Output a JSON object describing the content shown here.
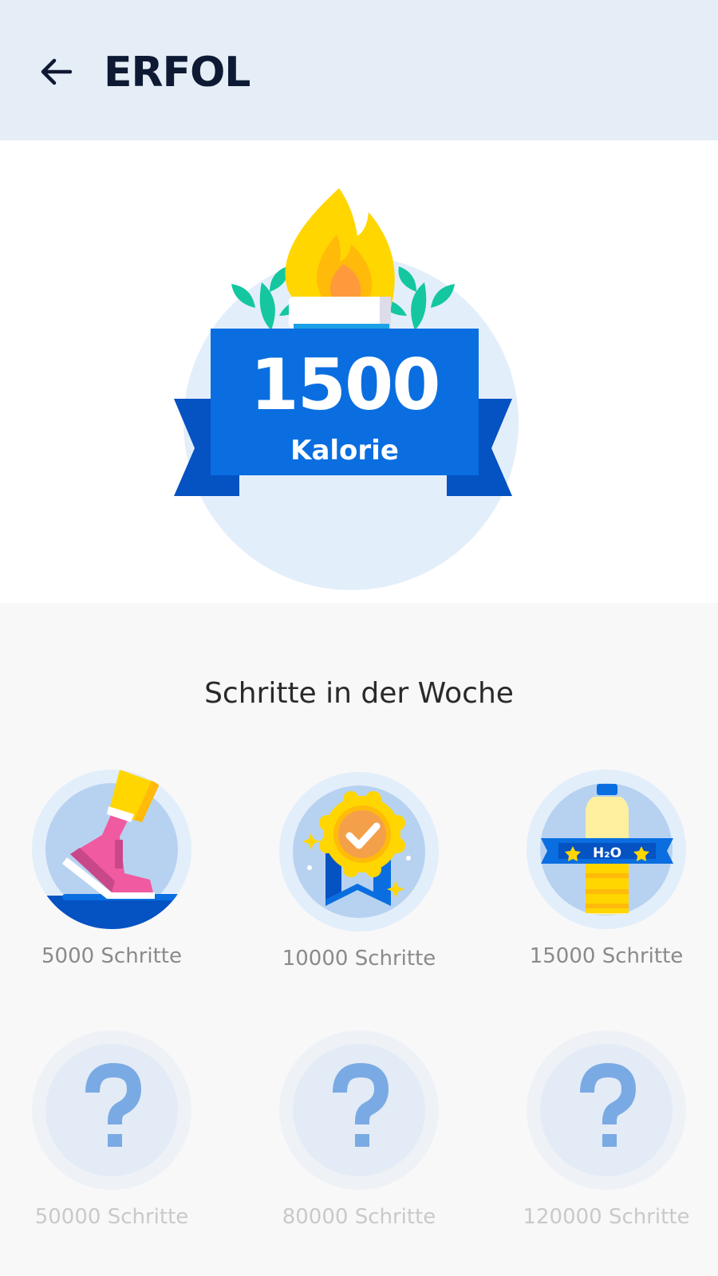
{
  "header": {
    "title": "ERFOL",
    "back_icon": "arrow-left-icon"
  },
  "hero": {
    "value": "1500",
    "unit": "Kalorie",
    "icon": "torch-flame-icon"
  },
  "section": {
    "title": "Schritte in der Woche"
  },
  "achievements": [
    {
      "label": "5000 Schritte",
      "icon": "sneaker-icon",
      "unlocked": true
    },
    {
      "label": "10000 Schritte",
      "icon": "medal-check-icon",
      "unlocked": true
    },
    {
      "label": "15000 Schritte",
      "icon": "water-bottle-icon",
      "bottle_text": "H₂O",
      "unlocked": true
    },
    {
      "label": "50000 Schritte",
      "icon": "question-mark-icon",
      "unlocked": false
    },
    {
      "label": "80000 Schritte",
      "icon": "question-mark-icon",
      "unlocked": false
    },
    {
      "label": "120000 Schritte",
      "icon": "question-mark-icon",
      "unlocked": false
    }
  ],
  "colors": {
    "header_bg": "#e5edf6",
    "primary_blue": "#0a6ee0",
    "dark_blue": "#0552c2",
    "flame_yellow": "#ffd600",
    "leaf_green": "#14c7a0"
  }
}
